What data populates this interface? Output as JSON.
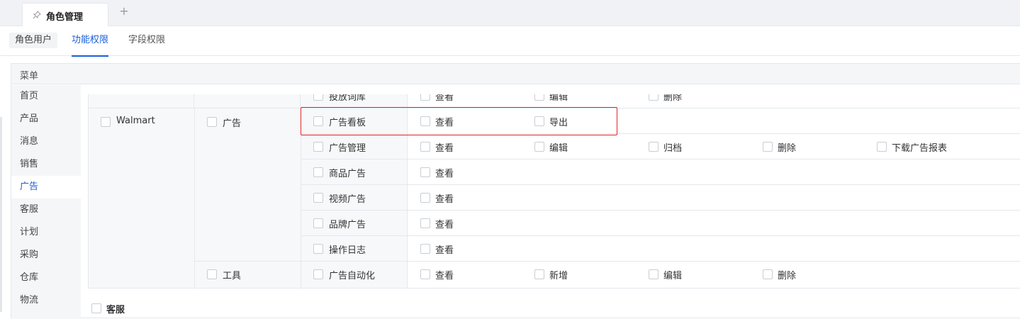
{
  "tabbar": {
    "active_tab": "角色管理",
    "add_label": "+"
  },
  "subtabs": [
    "角色用户",
    "功能权限",
    "字段权限"
  ],
  "panel": {
    "header": "菜单"
  },
  "menu": [
    "首页",
    "产品",
    "消息",
    "销售",
    "广告",
    "客服",
    "计划",
    "采购",
    "仓库",
    "物流"
  ],
  "menu_active": "广告",
  "table": {
    "partial_row": {
      "module": "投放词库",
      "perms": [
        "查看",
        "编辑",
        "删除"
      ]
    },
    "platform": "Walmart",
    "groups": [
      {
        "name": "广告",
        "rows": [
          {
            "module": "广告看板",
            "perms": [
              "查看",
              "导出"
            ]
          },
          {
            "module": "广告管理",
            "perms": [
              "查看",
              "编辑",
              "归档",
              "删除",
              "下载广告报表"
            ]
          },
          {
            "module": "商品广告",
            "perms": [
              "查看"
            ]
          },
          {
            "module": "视频广告",
            "perms": [
              "查看"
            ]
          },
          {
            "module": "品牌广告",
            "perms": [
              "查看"
            ]
          },
          {
            "module": "操作日志",
            "perms": [
              "查看"
            ]
          }
        ]
      },
      {
        "name": "工具",
        "rows": [
          {
            "module": "广告自动化",
            "perms": [
              "查看",
              "新增",
              "编辑",
              "删除"
            ]
          }
        ]
      }
    ]
  },
  "footer_section": "客服",
  "colors": {
    "accent": "#1b5fd9",
    "highlight": "#e0252b"
  }
}
